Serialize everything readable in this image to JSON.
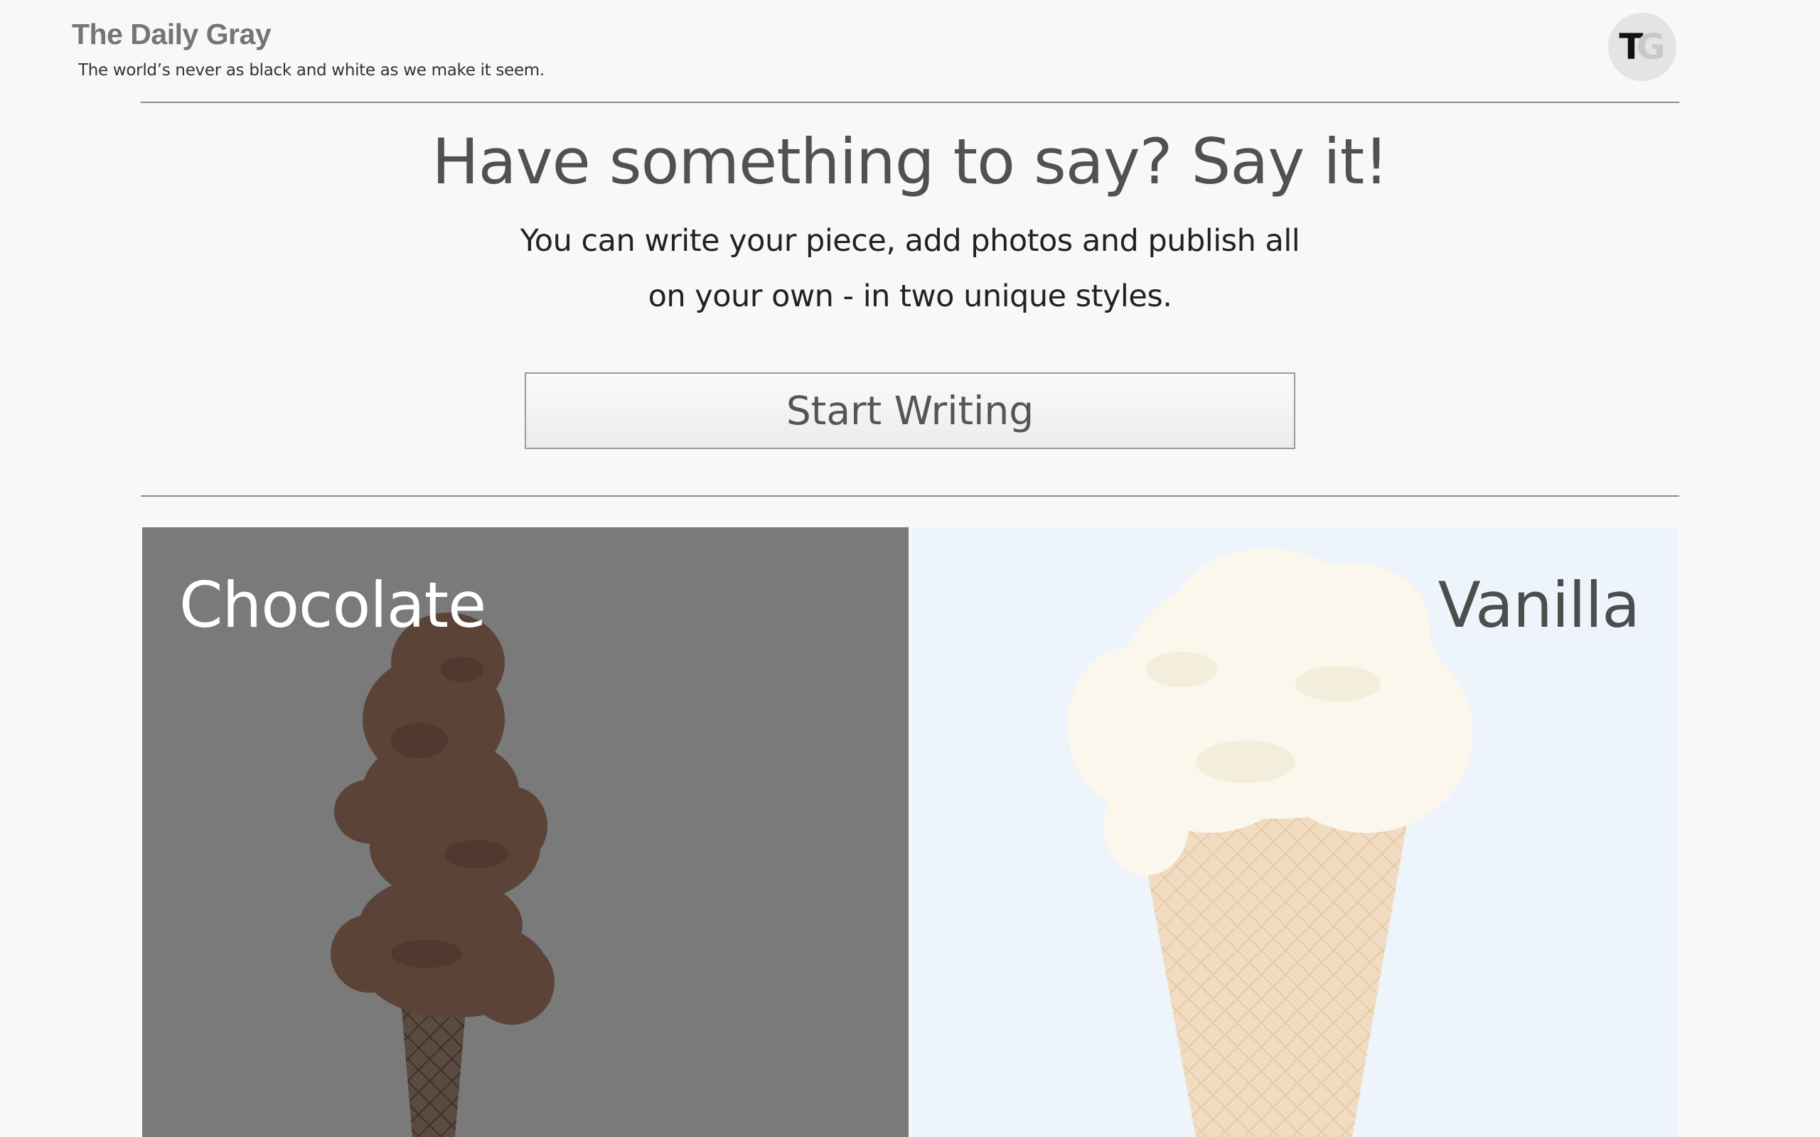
{
  "header": {
    "title": "The Daily Gray",
    "tagline": "The world’s never as black and white as we make it seem.",
    "avatar": {
      "letter_1": "T",
      "letter_2": "G"
    }
  },
  "hero": {
    "title": "Have something to say? Say it!",
    "subtitle_line_1": "You can write your piece, add photos and publish all",
    "subtitle_line_2": "on your own - in two unique styles.",
    "cta_label": "Start Writing"
  },
  "styles": [
    {
      "label": "Chocolate",
      "color": "#7a7a7a"
    },
    {
      "label": "Vanilla",
      "color": "#eef4fb"
    }
  ]
}
